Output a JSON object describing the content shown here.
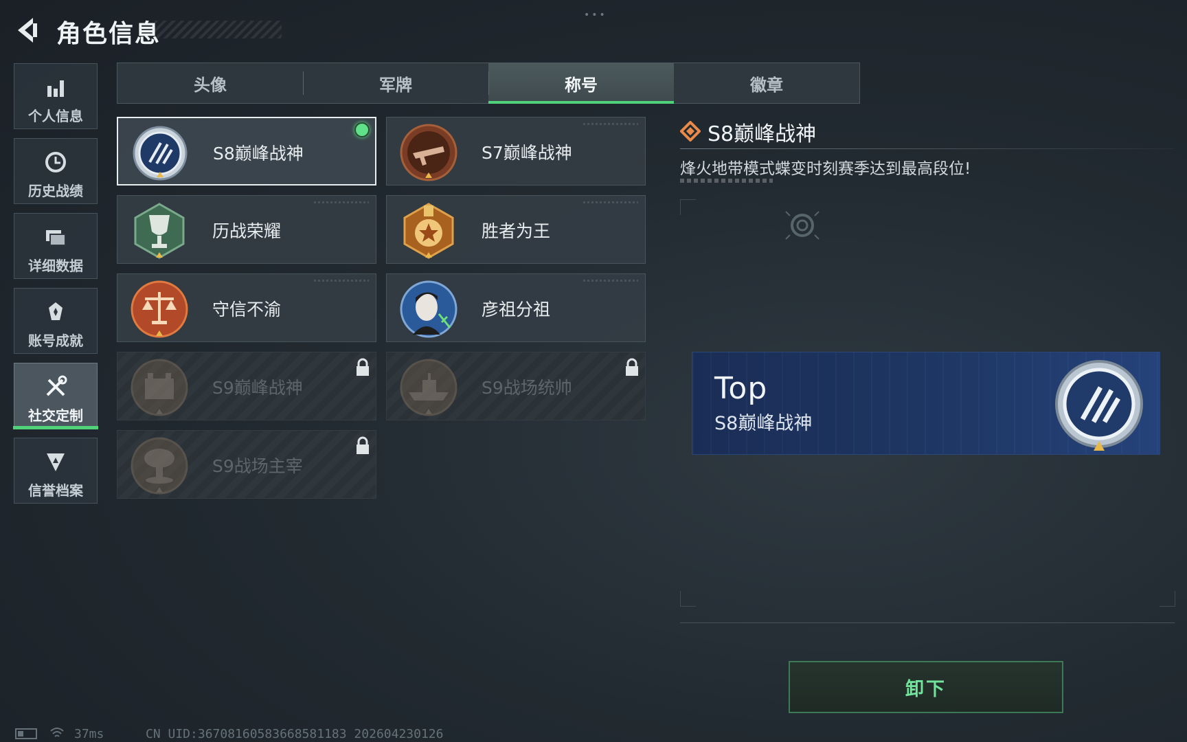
{
  "header": {
    "title": "角色信息"
  },
  "sidebar": {
    "items": [
      {
        "label": "个人信息",
        "icon": "bar-chart-icon"
      },
      {
        "label": "历史战绩",
        "icon": "history-clock-icon"
      },
      {
        "label": "详细数据",
        "icon": "folder-icon"
      },
      {
        "label": "账号成就",
        "icon": "achievement-icon"
      },
      {
        "label": "社交定制",
        "icon": "tools-icon",
        "active": true
      },
      {
        "label": "信誉档案",
        "icon": "shield-icon"
      }
    ]
  },
  "tabs": [
    {
      "label": "头像"
    },
    {
      "label": "军牌"
    },
    {
      "label": "称号",
      "active": true
    },
    {
      "label": "徽章"
    }
  ],
  "titles": [
    {
      "name": "S8巅峰战神",
      "state": "equipped",
      "icon": "s8-peak-emblem-icon"
    },
    {
      "name": "S7巅峰战神",
      "state": "owned",
      "icon": "s7-peak-emblem-icon"
    },
    {
      "name": "历战荣耀",
      "state": "owned",
      "icon": "trophy-emblem-icon"
    },
    {
      "name": "胜者为王",
      "state": "owned",
      "icon": "medal-emblem-icon"
    },
    {
      "name": "守信不渝",
      "state": "owned",
      "icon": "scales-emblem-icon"
    },
    {
      "name": "彦祖分祖",
      "state": "owned",
      "icon": "portrait-emblem-icon"
    },
    {
      "name": "S9巅峰战神",
      "state": "locked",
      "icon": "fortress-emblem-icon"
    },
    {
      "name": "S9战场统帅",
      "state": "locked",
      "icon": "warship-emblem-icon"
    },
    {
      "name": "S9战场主宰",
      "state": "locked",
      "icon": "mushroom-cloud-emblem-icon"
    }
  ],
  "detail": {
    "title": "S8巅峰战神",
    "description": "烽火地带模式蝶变时刻赛季达到最高段位!",
    "preview_top": "Top",
    "preview_title": "S8巅峰战神",
    "action_label": "卸下"
  },
  "footer": {
    "ping": "37ms",
    "uid": "CN UID:3670816058366858118З 202604230126"
  },
  "colors": {
    "accent_green": "#4fd27a",
    "preview_blue": "#1f3866",
    "title_orange": "#e98a4a"
  }
}
